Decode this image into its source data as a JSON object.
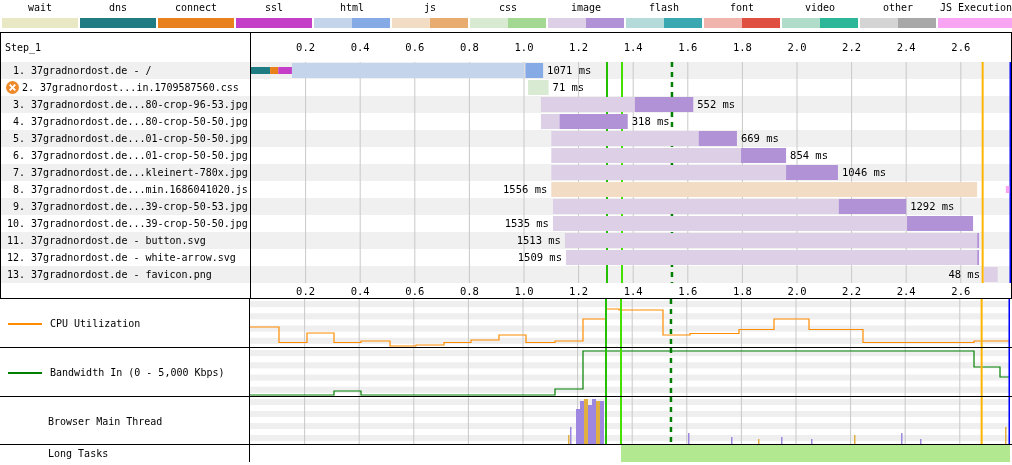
{
  "legend": [
    {
      "label": "wait",
      "segments": [
        {
          "color": "#e8e8c4"
        }
      ]
    },
    {
      "label": "dns",
      "segments": [
        {
          "color": "#1e7c82"
        }
      ]
    },
    {
      "label": "connect",
      "segments": [
        {
          "color": "#e8801c"
        }
      ]
    },
    {
      "label": "ssl",
      "segments": [
        {
          "color": "#c43ec8"
        }
      ]
    },
    {
      "label": "html",
      "segments": [
        {
          "color": "#c4d4ea"
        },
        {
          "color": "#86aae6"
        }
      ]
    },
    {
      "label": "js",
      "segments": [
        {
          "color": "#f2dcc4"
        },
        {
          "color": "#e8ac70"
        }
      ]
    },
    {
      "label": "css",
      "segments": [
        {
          "color": "#d8ead2"
        },
        {
          "color": "#a2d892"
        }
      ]
    },
    {
      "label": "image",
      "segments": [
        {
          "color": "#dccfe6"
        },
        {
          "color": "#b192d6"
        }
      ]
    },
    {
      "label": "flash",
      "segments": [
        {
          "color": "#b4dada"
        },
        {
          "color": "#3aa8b0"
        }
      ]
    },
    {
      "label": "font",
      "segments": [
        {
          "color": "#f0b4ac"
        },
        {
          "color": "#e05040"
        }
      ]
    },
    {
      "label": "video",
      "segments": [
        {
          "color": "#b0dcca"
        },
        {
          "color": "#2cb898"
        }
      ]
    },
    {
      "label": "other",
      "segments": [
        {
          "color": "#d4d4d4"
        },
        {
          "color": "#a8a8a8"
        }
      ]
    },
    {
      "label": "JS Execution",
      "segments": [
        {
          "color": "#f8a4f2"
        }
      ]
    }
  ],
  "waterfall": {
    "step": "Step_1",
    "top_ticks": [
      "0.2",
      "0.4",
      "0.6",
      "0.8",
      "1.0",
      "1.2",
      "1.4",
      "1.6",
      "1.8",
      "2.0",
      "2.2",
      "2.4",
      "2.6"
    ],
    "rows": [
      {
        "label": "1. 37gradnordost.de - /",
        "duration": "1071 ms",
        "kind": "html",
        "error": false
      },
      {
        "label": "2. 37gradnordost...in.1709587560.css",
        "duration": "71 ms",
        "kind": "css",
        "error": true
      },
      {
        "label": "3. 37gradnordost.de...80-crop-96-53.jpg",
        "duration": "552 ms",
        "kind": "image",
        "error": false
      },
      {
        "label": "4. 37gradnordost.de...80-crop-50-50.jpg",
        "duration": "318 ms",
        "kind": "image",
        "error": false
      },
      {
        "label": "5. 37gradnordost.de...01-crop-50-50.jpg",
        "duration": "669 ms",
        "kind": "image",
        "error": false
      },
      {
        "label": "6. 37gradnordost.de...01-crop-50-50.jpg",
        "duration": "854 ms",
        "kind": "image",
        "error": false
      },
      {
        "label": "7. 37gradnordost.de...kleinert-780x.jpg",
        "duration": "1046 ms",
        "kind": "image",
        "error": false
      },
      {
        "label": "8. 37gradnordost.de...min.1686041020.js",
        "duration": "1556 ms",
        "kind": "js",
        "error": false
      },
      {
        "label": "9. 37gradnordost.de...39-crop-50-53.jpg",
        "duration": "1292 ms",
        "kind": "image",
        "error": false
      },
      {
        "label": "10. 37gradnordost.de...39-crop-50-50.jpg",
        "duration": "1535 ms",
        "kind": "image",
        "error": false
      },
      {
        "label": "11. 37gradnordost.de - button.svg",
        "duration": "1513 ms",
        "kind": "image",
        "error": false
      },
      {
        "label": "12. 37gradnordost.de - white-arrow.svg",
        "duration": "1509 ms",
        "kind": "image",
        "error": false
      },
      {
        "label": "13. 37gradnordost.de - favicon.png",
        "duration": "48 ms",
        "kind": "image",
        "error": false
      }
    ],
    "bottom_ticks": [
      "0.2",
      "0.4",
      "0.6",
      "0.8",
      "1.0",
      "1.2",
      "1.4",
      "1.6",
      "1.8",
      "2.0",
      "2.2",
      "2.4",
      "2.6"
    ]
  },
  "panels": [
    {
      "label": "CPU Utilization",
      "kind": "cpu",
      "color": "#ff8c00"
    },
    {
      "label": "Bandwidth In (0 - 5,000 Kbps)",
      "kind": "bandwidth",
      "color": "#008000"
    },
    {
      "label": "Browser Main Thread",
      "kind": "main_thread"
    },
    {
      "label": "Long Tasks",
      "kind": "long_tasks"
    }
  ]
}
